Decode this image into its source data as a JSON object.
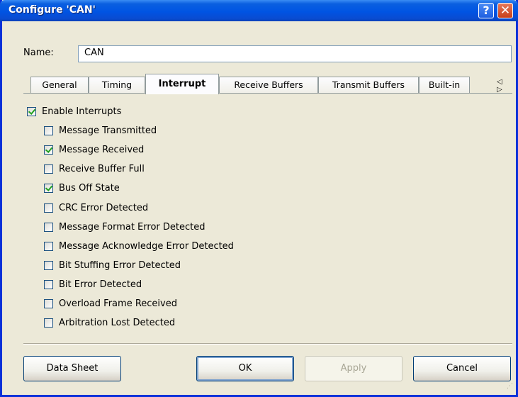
{
  "window": {
    "title": "Configure 'CAN'",
    "help_glyph": "?",
    "close_glyph": "✕"
  },
  "name_field": {
    "label": "Name:",
    "value": "CAN"
  },
  "tabs": [
    {
      "label": "General",
      "active": false
    },
    {
      "label": "Timing",
      "active": false
    },
    {
      "label": "Interrupt",
      "active": true
    },
    {
      "label": "Receive Buffers",
      "active": false
    },
    {
      "label": "Transmit Buffers",
      "active": false
    },
    {
      "label": "Built-in",
      "active": false
    }
  ],
  "tab_scroll_arrows": "◁ ▷",
  "interrupt": {
    "enable": {
      "label": "Enable Interrupts",
      "checked": true
    },
    "items": [
      {
        "label": "Message Transmitted",
        "checked": false
      },
      {
        "label": "Message Received",
        "checked": true
      },
      {
        "label": "Receive Buffer Full",
        "checked": false
      },
      {
        "label": "Bus Off State",
        "checked": true
      },
      {
        "label": "CRC Error Detected",
        "checked": false
      },
      {
        "label": "Message Format Error Detected",
        "checked": false
      },
      {
        "label": "Message Acknowledge Error Detected",
        "checked": false
      },
      {
        "label": "Bit Stuffing Error Detected",
        "checked": false
      },
      {
        "label": "Bit Error Detected",
        "checked": false
      },
      {
        "label": "Overload Frame Received",
        "checked": false
      },
      {
        "label": "Arbitration Lost Detected",
        "checked": false
      }
    ]
  },
  "buttons": {
    "data_sheet": "Data Sheet",
    "ok": "OK",
    "apply": "Apply",
    "cancel": "Cancel"
  },
  "colors": {
    "titlebar": "#0054e3",
    "dialog_bg": "#ece9d8",
    "check_mark": "#21a121"
  }
}
